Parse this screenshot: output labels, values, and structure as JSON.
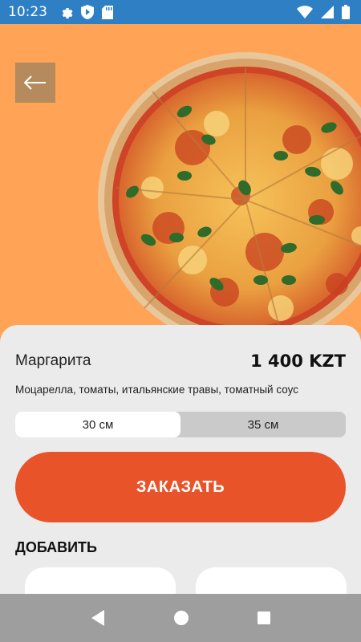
{
  "status_bar": {
    "time": "10:23",
    "left_icons": [
      "gear-icon",
      "play-protect-icon",
      "sd-card-icon"
    ],
    "right_icons": [
      "wifi-icon",
      "cell-signal-icon",
      "battery-icon"
    ]
  },
  "hero": {
    "background_color": "#ffa356",
    "back_icon": "arrow-left-icon",
    "image": "pizza-margherita"
  },
  "product": {
    "name": "Маргарита",
    "price": "1 400 KZT",
    "description": "Моцарелла, томаты, итальянские травы, томатный соус"
  },
  "sizes": {
    "options": [
      "30 см",
      "35 см"
    ],
    "selected": "30 см"
  },
  "order_button": {
    "label": "ЗАКАЗАТЬ",
    "color": "#e8532a"
  },
  "addons": {
    "heading": "ДОБАВИТЬ"
  },
  "nav_bar": {
    "buttons": [
      "back-triangle-icon",
      "home-circle-icon",
      "recents-square-icon"
    ]
  }
}
